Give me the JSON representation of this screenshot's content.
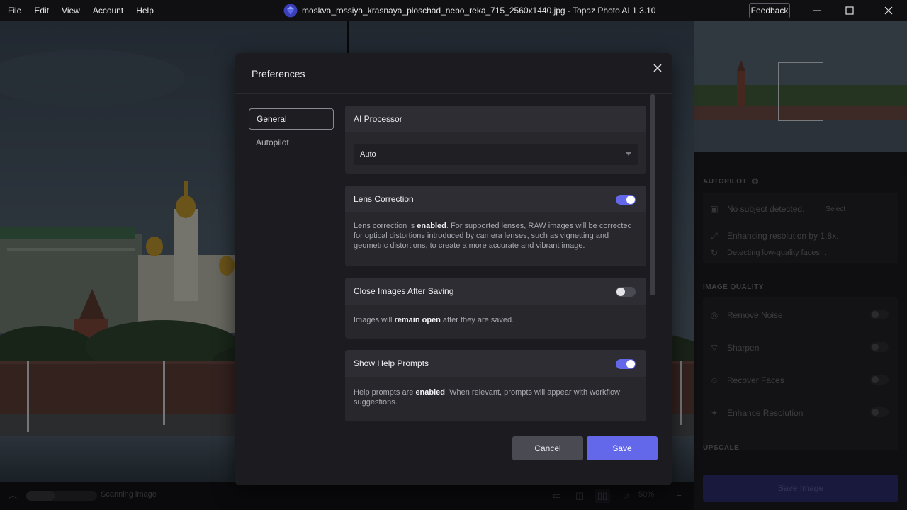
{
  "titlebar": {
    "menu": [
      "File",
      "Edit",
      "View",
      "Account",
      "Help"
    ],
    "title": "moskva_rossiya_krasnaya_ploschad_nebo_reka_715_2560x1440.jpg - Topaz Photo AI 1.3.10",
    "feedback_label": "Feedback",
    "app_icon": "topaz-gem-icon",
    "window_controls": [
      "minimize-icon",
      "maximize-icon",
      "close-icon"
    ]
  },
  "right_panel": {
    "autopilot_label": "AUTOPILOT",
    "subject_status": "No subject detected.",
    "select_label": "Select",
    "enhance_status": "Enhancing resolution by 1.8x.",
    "faces_status": "Detecting low-quality faces...",
    "image_quality_label": "IMAGE QUALITY",
    "filters": [
      {
        "label": "Remove Noise",
        "icon": "noise-icon"
      },
      {
        "label": "Sharpen",
        "icon": "sharpen-icon"
      },
      {
        "label": "Recover Faces",
        "icon": "face-icon"
      },
      {
        "label": "Enhance Resolution",
        "icon": "resolution-icon"
      }
    ],
    "upscale_label": "UPSCALE",
    "save_image_label": "Save Image"
  },
  "bottombar": {
    "scan_text": "Scanning image",
    "scan_progress": 0.4,
    "zoom_text": "50%"
  },
  "dialog": {
    "title": "Preferences",
    "nav": {
      "general": "General",
      "autopilot": "Autopilot"
    },
    "ai_processor": {
      "title": "AI Processor",
      "value": "Auto"
    },
    "lens_correction": {
      "title": "Lens Correction",
      "enabled": true,
      "desc_pre": "Lens correction is ",
      "desc_bold": "enabled",
      "desc_post": ". For supported lenses, RAW images will be corrected for optical distortions introduced by camera lenses, such as vignetting and geometric distortions, to create a more accurate and vibrant image."
    },
    "close_after_saving": {
      "title": "Close Images After Saving",
      "enabled": false,
      "desc_pre": "Images will ",
      "desc_bold": "remain open",
      "desc_post": " after they are saved."
    },
    "help_prompts": {
      "title": "Show Help Prompts",
      "enabled": true,
      "desc_pre": "Help prompts are ",
      "desc_bold": "enabled",
      "desc_post": ". When relevant, prompts will appear with workflow suggestions."
    },
    "cancel_label": "Cancel",
    "save_label": "Save"
  }
}
